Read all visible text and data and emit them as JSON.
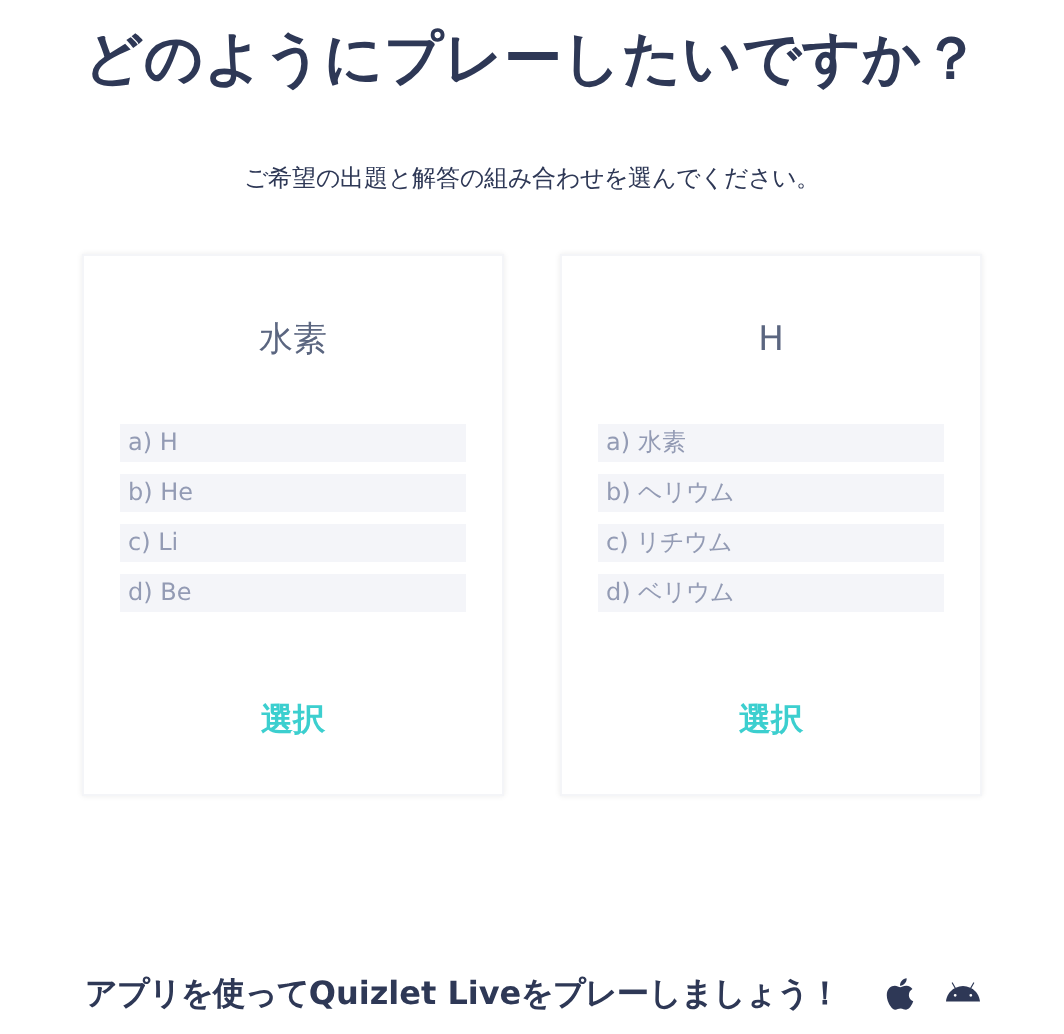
{
  "title": "どのようにプレーしたいですか？",
  "subtitle": "ご希望の出題と解答の組み合わせを選んでください。",
  "cards": [
    {
      "prompt": "水素",
      "options": [
        "a) H",
        "b) He",
        "c) Li",
        "d) Be"
      ],
      "button": "選択"
    },
    {
      "prompt": "H",
      "options": [
        "a) 水素",
        "b) ヘリウム",
        "c) リチウム",
        "d) ベリウム"
      ],
      "button": "選択"
    }
  ],
  "footer": "アプリを使ってQuizlet Liveをプレーしましょう！"
}
